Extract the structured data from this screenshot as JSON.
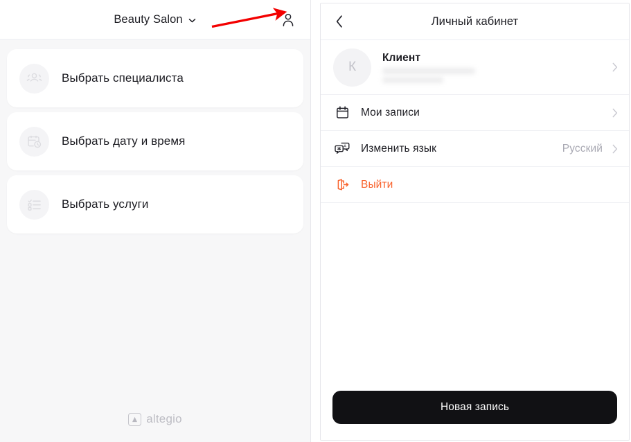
{
  "left_panel": {
    "header": {
      "salon_name": "Beauty Salon",
      "dropdown_icon": "chevron-down-icon",
      "profile_icon": "person-icon"
    },
    "cards": [
      {
        "label": "Выбрать специалиста",
        "icon": "people-group-icon"
      },
      {
        "label": "Выбрать дату и время",
        "icon": "calendar-clock-icon"
      },
      {
        "label": "Выбрать услуги",
        "icon": "checklist-icon"
      }
    ],
    "footer": {
      "brand": "altegio",
      "brand_icon": "altegio-logo-icon"
    }
  },
  "right_panel": {
    "header": {
      "back_icon": "chevron-left-icon",
      "title": "Личный кабинет"
    },
    "profile": {
      "avatar_initial": "К",
      "name": "Клиент",
      "contact_redacted": true,
      "chevron_icon": "chevron-right-icon"
    },
    "menu": [
      {
        "label": "Мои записи",
        "icon": "calendar-icon",
        "value": "",
        "chevron_icon": "chevron-right-icon",
        "danger": false
      },
      {
        "label": "Изменить язык",
        "icon": "translate-icon",
        "value": "Русский",
        "chevron_icon": "chevron-right-icon",
        "danger": false
      },
      {
        "label": "Выйти",
        "icon": "logout-icon",
        "value": "",
        "chevron_icon": "",
        "danger": true
      }
    ],
    "footer": {
      "primary_button": "Новая запись"
    }
  },
  "annotation": {
    "type": "red-arrow",
    "points_to": "person-icon",
    "color": "#f30000"
  },
  "colors": {
    "accent_danger": "#f9622c",
    "panel_background": "#f7f7f8",
    "card_background": "#ffffff",
    "primary_button": "#111114",
    "muted_text": "#a9a9b3",
    "annotation": "#f30000"
  }
}
